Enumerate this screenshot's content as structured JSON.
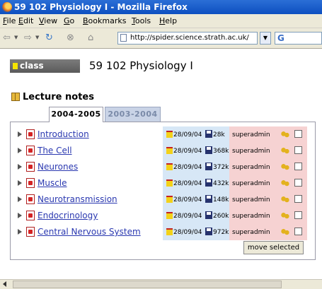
{
  "window": {
    "title": "59 102 Physiology I - Mozilla Firefox"
  },
  "menu": [
    "File",
    "Edit",
    "View",
    "Go",
    "Bookmarks",
    "Tools",
    "Help"
  ],
  "nav": {
    "url": "http://spider.science.strath.ac.uk/",
    "search_label": "G",
    "icons": [
      "back-icon",
      "forward-icon",
      "reload-icon",
      "stop-icon",
      "home-icon"
    ]
  },
  "page": {
    "class_label": "class",
    "title": "59 102 Physiology I",
    "section_title": "Lecture notes",
    "tabs": [
      {
        "label": "2004-2005",
        "active": true
      },
      {
        "label": "2003-2004",
        "active": false
      }
    ],
    "rows": [
      {
        "name": "Introduction",
        "date": "28/09/04",
        "size": "28k",
        "owner": "superadmin"
      },
      {
        "name": "The Cell",
        "date": "28/09/04",
        "size": "368k",
        "owner": "superadmin"
      },
      {
        "name": "Neurones",
        "date": "28/09/04",
        "size": "372k",
        "owner": "superadmin"
      },
      {
        "name": "Muscle",
        "date": "28/09/04",
        "size": "432k",
        "owner": "superadmin"
      },
      {
        "name": "Neurotransmission",
        "date": "28/09/04",
        "size": "148k",
        "owner": "superadmin"
      },
      {
        "name": "Endocrinology",
        "date": "28/09/04",
        "size": "260k",
        "owner": "superadmin"
      },
      {
        "name": "Central Nervous System",
        "date": "28/09/04",
        "size": "972k",
        "owner": "superadmin"
      }
    ],
    "move_button": "move selected"
  },
  "colors": {
    "titlebar": "#0d4fc0",
    "info_cell": "#d7e7f6",
    "owner_cell": "#f6d2d2",
    "link": "#2a38b0",
    "class_badge": "#6b6b6b",
    "badge_marker": "#f5e400"
  }
}
